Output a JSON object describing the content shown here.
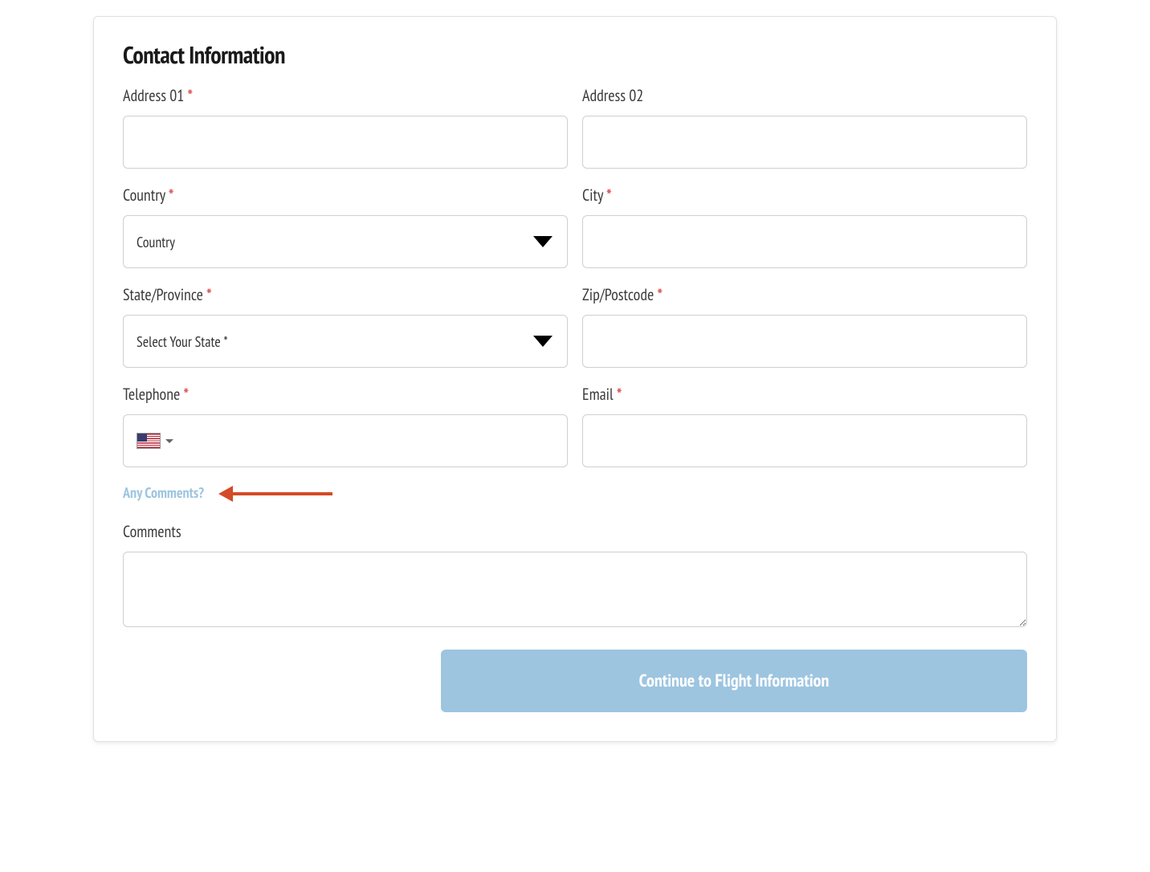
{
  "section_title": "Contact Information",
  "fields": {
    "address1": {
      "label": "Address 01",
      "required": true,
      "value": ""
    },
    "address2": {
      "label": "Address 02",
      "required": false,
      "value": ""
    },
    "country": {
      "label": "Country",
      "required": true,
      "selected": "Country"
    },
    "city": {
      "label": "City",
      "required": true,
      "value": ""
    },
    "state": {
      "label": "State/Province",
      "required": true,
      "selected": "Select Your State *"
    },
    "zip": {
      "label": "Zip/Postcode",
      "required": true,
      "value": ""
    },
    "telephone": {
      "label": "Telephone",
      "required": true,
      "value": "",
      "flag": "us"
    },
    "email": {
      "label": "Email",
      "required": true,
      "value": ""
    }
  },
  "comments_toggle": "Any Comments?",
  "comments": {
    "label": "Comments",
    "value": ""
  },
  "submit_button": "Continue to Flight Information",
  "required_marker": "*",
  "colors": {
    "accent": "#9dc5e0",
    "required": "#d9534f",
    "annotation": "#d44a26"
  }
}
